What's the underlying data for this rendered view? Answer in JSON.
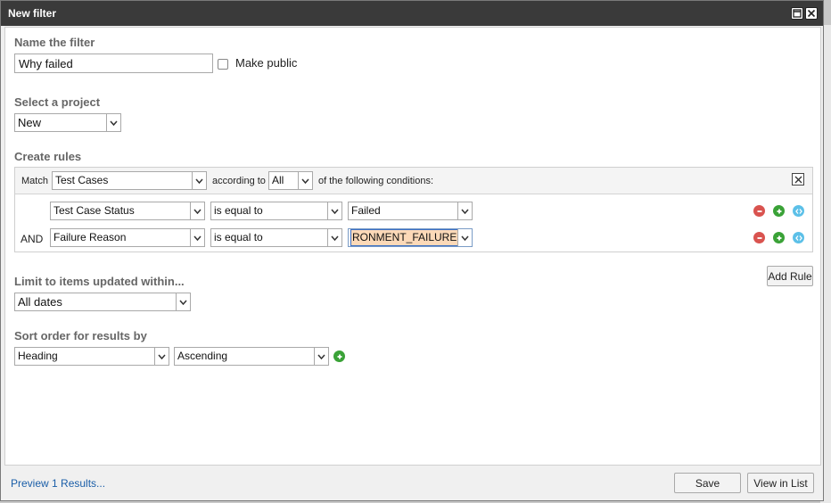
{
  "window": {
    "title": "New filter",
    "maximize_icon": "maximize-icon",
    "close_icon": "close-icon"
  },
  "name_section": {
    "label": "Name the filter",
    "value": "Why failed",
    "make_public_label": "Make public",
    "make_public_checked": false
  },
  "project_section": {
    "label": "Select a project",
    "selected": "New"
  },
  "rules_section": {
    "label": "Create rules",
    "match_label": "Match",
    "match_selected": "Test Cases",
    "according_to_label": "according to",
    "according_selected": "All",
    "conditions_text": "of the following conditions:",
    "rules": [
      {
        "prefix": "",
        "field": "Test Case Status",
        "operator": "is equal to",
        "value": "Failed"
      },
      {
        "prefix": "AND",
        "field": "Failure Reason",
        "operator": "is equal to",
        "value": "RONMENT_FAILURE"
      }
    ],
    "add_rule_label": "Add Rule"
  },
  "limit_section": {
    "label": "Limit to items updated within...",
    "selected": "All dates"
  },
  "sort_section": {
    "label": "Sort order for results by",
    "field_selected": "Heading",
    "order_selected": "Ascending"
  },
  "footer": {
    "preview_link": "Preview 1 Results...",
    "save_label": "Save",
    "view_in_list_label": "View in List"
  },
  "colors": {
    "titlebar": "#3a3a3a",
    "remove": "#d9534f",
    "add": "#3aa237",
    "info": "#5cc0e8",
    "highlight": "#fcd9b8"
  }
}
